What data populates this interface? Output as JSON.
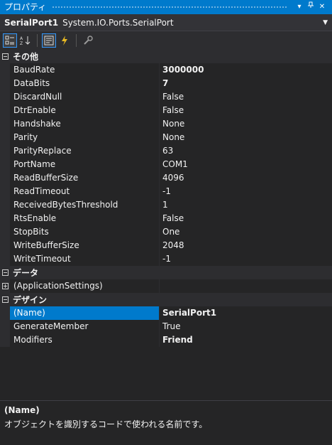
{
  "window": {
    "title": "プロパティ"
  },
  "object_selector": {
    "name": "SerialPort1",
    "type": "System.IO.Ports.SerialPort"
  },
  "toolbar": [
    "categorized-icon",
    "alphabetical-icon",
    "properties-icon",
    "events-icon",
    "property-pages-icon"
  ],
  "categories": {
    "other": {
      "label": "その他",
      "props": [
        {
          "name": "BaudRate",
          "value": "3000000"
        },
        {
          "name": "DataBits",
          "value": "7"
        },
        {
          "name": "DiscardNull",
          "value": "False"
        },
        {
          "name": "DtrEnable",
          "value": "False"
        },
        {
          "name": "Handshake",
          "value": "None"
        },
        {
          "name": "Parity",
          "value": "None"
        },
        {
          "name": "ParityReplace",
          "value": "63"
        },
        {
          "name": "PortName",
          "value": "COM1"
        },
        {
          "name": "ReadBufferSize",
          "value": "4096"
        },
        {
          "name": "ReadTimeout",
          "value": "-1"
        },
        {
          "name": "ReceivedBytesThreshold",
          "value": "1"
        },
        {
          "name": "RtsEnable",
          "value": "False"
        },
        {
          "name": "StopBits",
          "value": "One"
        },
        {
          "name": "WriteBufferSize",
          "value": "2048"
        },
        {
          "name": "WriteTimeout",
          "value": "-1"
        }
      ]
    },
    "data": {
      "label": "データ",
      "sub": "(ApplicationSettings)"
    },
    "design": {
      "label": "デザイン",
      "props": [
        {
          "name": "(Name)",
          "value": "SerialPort1"
        },
        {
          "name": "GenerateMember",
          "value": "True"
        },
        {
          "name": "Modifiers",
          "value": "Friend"
        }
      ]
    }
  },
  "description": {
    "title": "(Name)",
    "text": "オブジェクトを識別するコードで使われる名前です。"
  },
  "colors": {
    "accent": "#007acc",
    "background": "#252526"
  }
}
